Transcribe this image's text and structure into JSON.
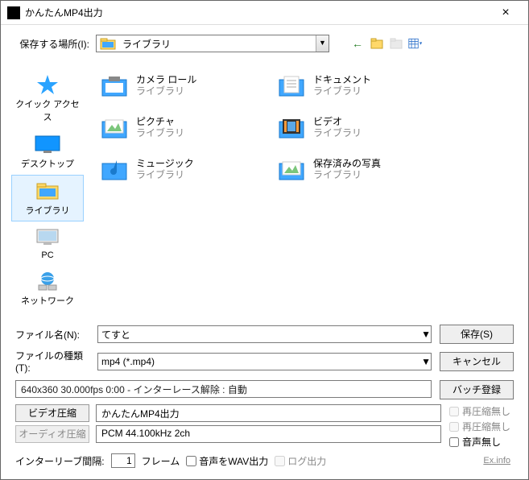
{
  "window": {
    "title": "かんたんMP4出力",
    "close": "×"
  },
  "toprow": {
    "label": "保存する場所(I):",
    "location": "ライブラリ"
  },
  "navicons": {
    "back": "←",
    "up": "📁",
    "new": "💭",
    "view": "▦"
  },
  "places": [
    {
      "label": "クイック アクセス"
    },
    {
      "label": "デスクトップ"
    },
    {
      "label": "ライブラリ",
      "selected": true
    },
    {
      "label": "PC"
    },
    {
      "label": "ネットワーク"
    }
  ],
  "files": [
    {
      "name": "カメラ ロール",
      "sub": "ライブラリ"
    },
    {
      "name": "ドキュメント",
      "sub": "ライブラリ"
    },
    {
      "name": "ピクチャ",
      "sub": "ライブラリ"
    },
    {
      "name": "ビデオ",
      "sub": "ライブラリ"
    },
    {
      "name": "ミュージック",
      "sub": "ライブラリ"
    },
    {
      "name": "保存済みの写真",
      "sub": "ライブラリ"
    }
  ],
  "filename": {
    "label": "ファイル名(N):",
    "value": "てすと"
  },
  "filetype": {
    "label": "ファイルの種類(T):",
    "value": "mp4 (*.mp4)"
  },
  "buttons": {
    "save": "保存(S)",
    "cancel": "キャンセル",
    "batch": "バッチ登録"
  },
  "status": "640x360 30.000fps 0:00 - インターレース解除 : 自動",
  "video": {
    "btn": "ビデオ圧縮",
    "value": "かんたんMP4出力"
  },
  "audio": {
    "btn": "オーディオ圧縮",
    "value": "PCM 44.100kHz 2ch"
  },
  "rightchecks": {
    "recomp1": "再圧縮無し",
    "recomp2": "再圧縮無し",
    "noaudio": "音声無し"
  },
  "footer": {
    "interleave_label": "インターリーブ間隔:",
    "interleave_value": "1",
    "interleave_unit": "フレーム",
    "wav": "音声をWAV出力",
    "log": "ログ出力",
    "exinfo": "Ex.info"
  }
}
